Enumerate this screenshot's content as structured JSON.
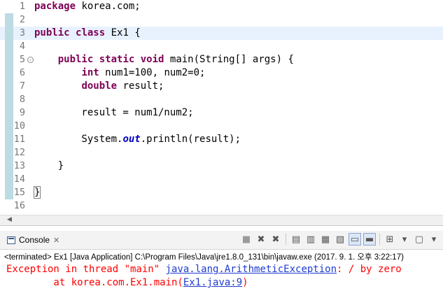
{
  "editor": {
    "lines": [
      {
        "n": "1",
        "code": [
          {
            "t": "package",
            "k": "kw"
          },
          {
            "t": " korea.com;"
          }
        ]
      },
      {
        "n": "2",
        "code": []
      },
      {
        "n": "3",
        "code": [
          {
            "t": "public",
            "k": "kw"
          },
          {
            "t": " "
          },
          {
            "t": "class",
            "k": "kw"
          },
          {
            "t": " Ex1 {"
          }
        ]
      },
      {
        "n": "4",
        "code": []
      },
      {
        "n": "5",
        "code": [
          {
            "t": "    "
          },
          {
            "t": "public",
            "k": "kw"
          },
          {
            "t": " "
          },
          {
            "t": "static",
            "k": "kw"
          },
          {
            "t": " "
          },
          {
            "t": "void",
            "k": "kw"
          },
          {
            "t": " main(String[] args) {"
          }
        ]
      },
      {
        "n": "6",
        "code": [
          {
            "t": "        "
          },
          {
            "t": "int",
            "k": "kw"
          },
          {
            "t": " num1=100, num2=0;"
          }
        ]
      },
      {
        "n": "7",
        "code": [
          {
            "t": "        "
          },
          {
            "t": "double",
            "k": "kw"
          },
          {
            "t": " result;"
          }
        ]
      },
      {
        "n": "8",
        "code": []
      },
      {
        "n": "9",
        "code": [
          {
            "t": "        result = num1/num2;"
          }
        ]
      },
      {
        "n": "10",
        "code": []
      },
      {
        "n": "11",
        "code": [
          {
            "t": "        System."
          },
          {
            "t": "out",
            "k": "fld"
          },
          {
            "t": ".println(result);"
          }
        ]
      },
      {
        "n": "12",
        "code": []
      },
      {
        "n": "13",
        "code": [
          {
            "t": "    }"
          }
        ]
      },
      {
        "n": "14",
        "code": []
      },
      {
        "n": "15",
        "code": [
          {
            "t": "}",
            "k": "bracket"
          }
        ]
      },
      {
        "n": "16",
        "code": []
      }
    ],
    "highlighted_line": 3,
    "folded_marker_line": 5,
    "fold_glyph": "⊖"
  },
  "scrollbar": {
    "left_arrow": "◀"
  },
  "console": {
    "tab_label": "Console",
    "tab_close": "✕",
    "toolbar": [
      "■",
      "✖",
      "✖",
      "▤",
      "▥",
      "▦",
      "▧",
      "▭",
      "▬",
      "⊞",
      "▾",
      "▢",
      "▾"
    ],
    "terminated_line": "<terminated> Ex1 [Java Application] C:\\Program Files\\Java\\jre1.8.0_131\\bin\\javaw.exe (2017. 9. 1. 오후 3:22:17)",
    "error_line1_prefix": "Exception in thread \"main\" ",
    "error_line1_link": "java.lang.ArithmeticException",
    "error_line1_suffix": ": / by zero",
    "error_line2_prefix": "        at korea.com.Ex1.main(",
    "error_line2_link": "Ex1.java:9",
    "error_line2_suffix": ")"
  },
  "colors": {
    "keyword": "#7f0055",
    "field": "#0000c0",
    "error": "#ff0000",
    "link": "#1f3bcf",
    "current_line": "#e8f2fe"
  }
}
